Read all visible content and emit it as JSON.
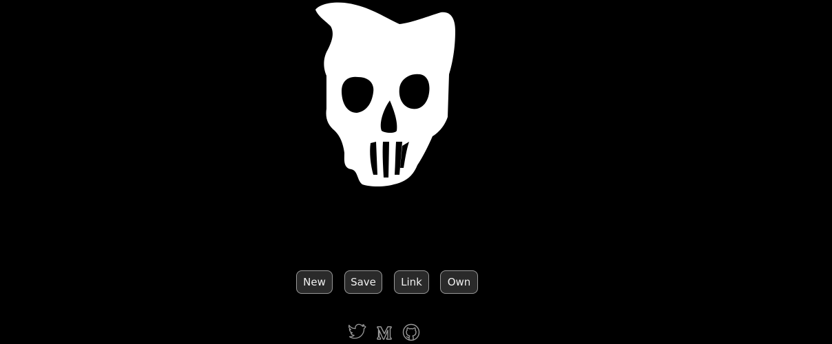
{
  "artwork": {
    "subject": "skull",
    "fill_color": "#ffffff",
    "background_color": "#000000"
  },
  "toolbar": {
    "buttons": [
      {
        "label": "New"
      },
      {
        "label": "Save"
      },
      {
        "label": "Link"
      },
      {
        "label": "Own"
      }
    ]
  },
  "social_links": [
    {
      "icon": "twitter-icon"
    },
    {
      "icon": "medium-icon"
    },
    {
      "icon": "github-icon"
    }
  ],
  "colors": {
    "button_bg": "#2a2a2a",
    "button_border": "#9a9a9a",
    "button_text": "#f0f0f0",
    "icon_stroke": "#9a9a9a"
  }
}
